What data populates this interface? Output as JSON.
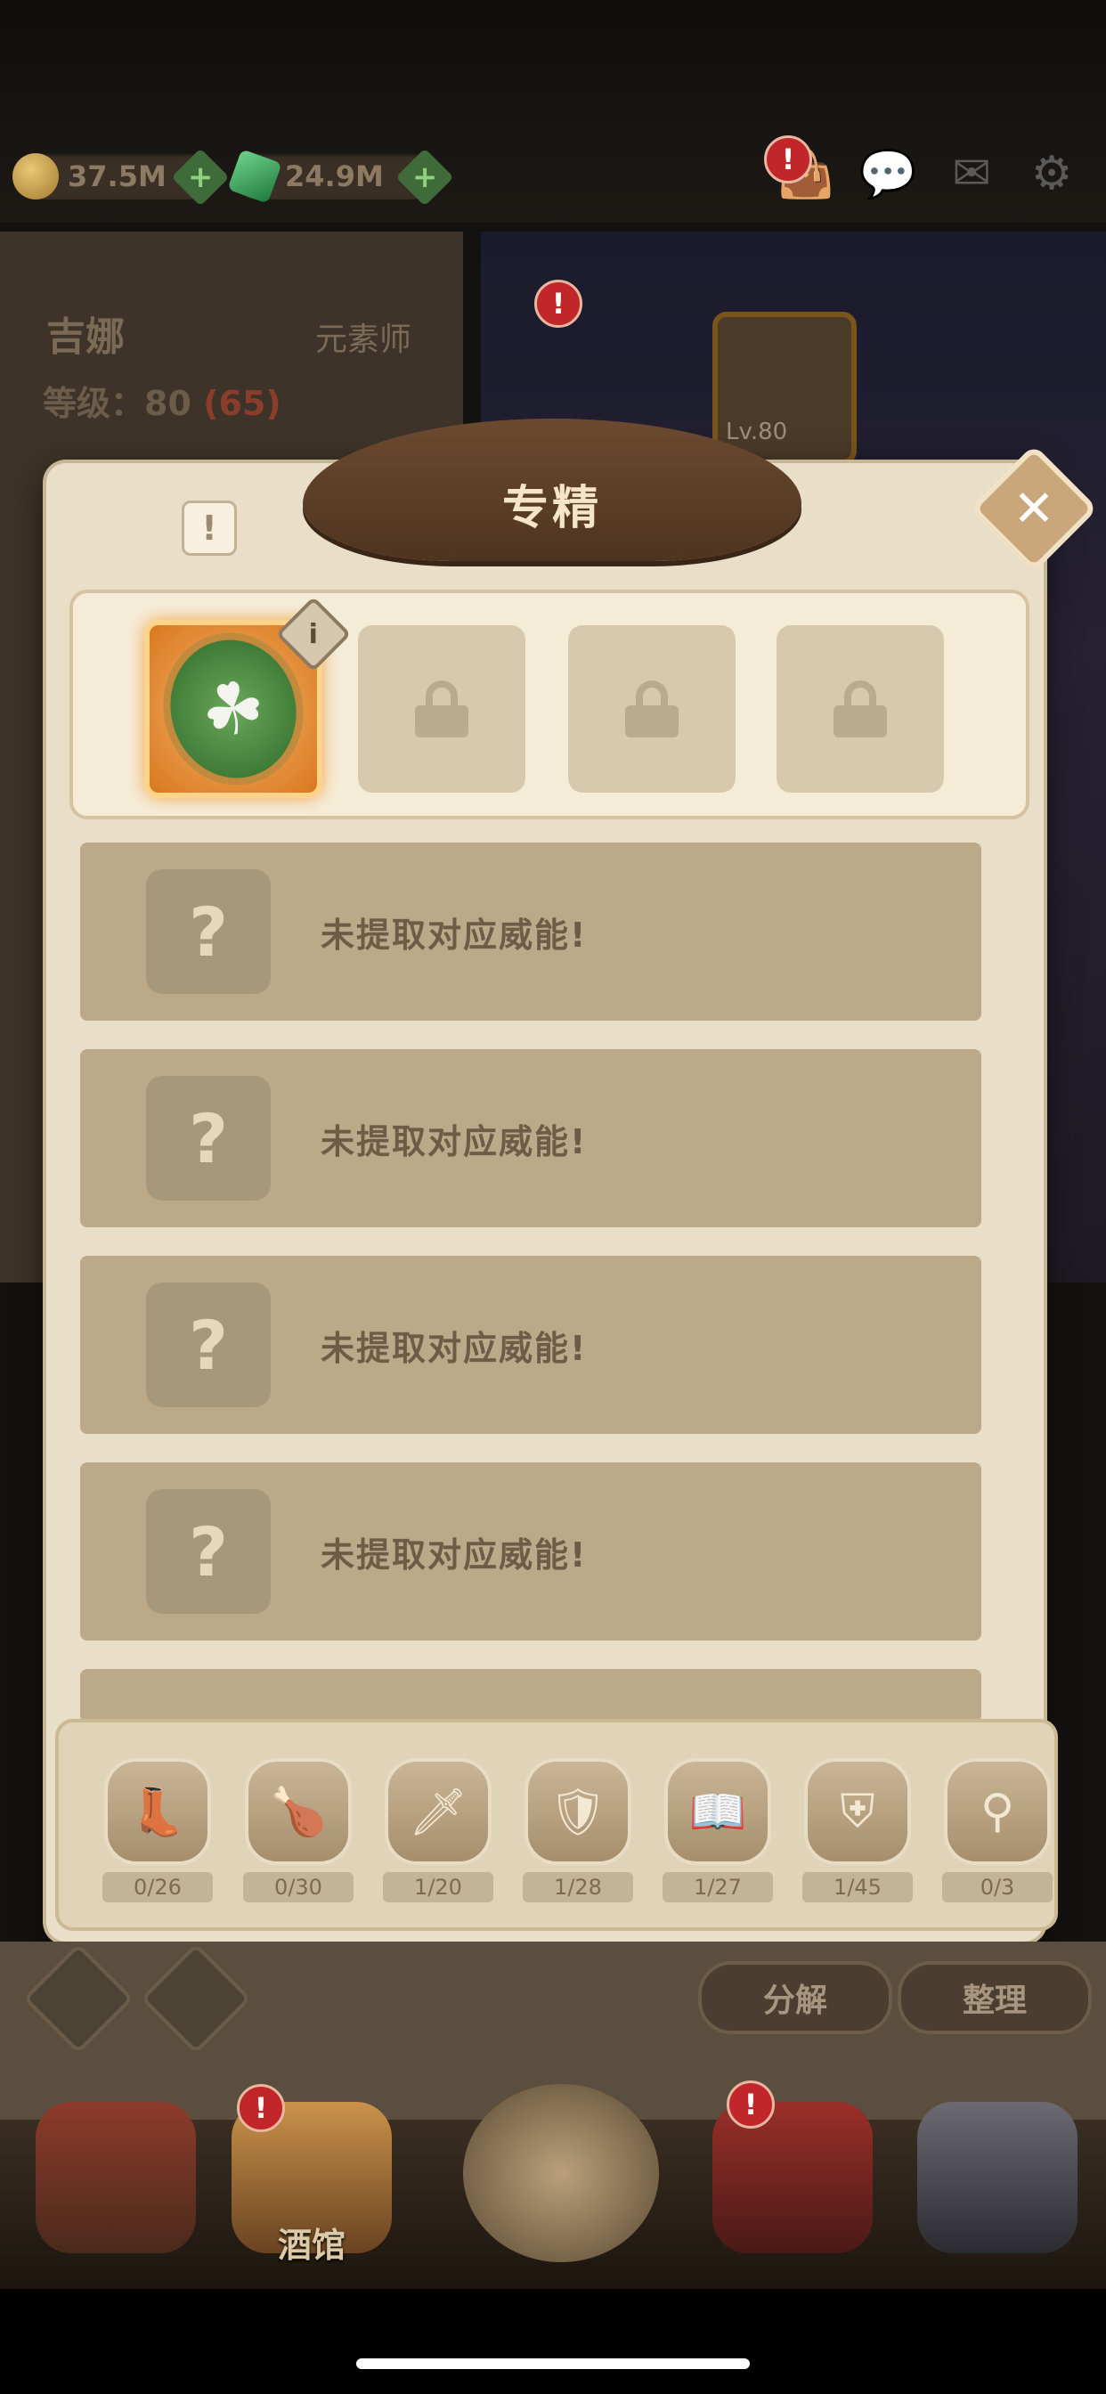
{
  "currency": {
    "gold": "37.5M",
    "gems": "24.9M"
  },
  "hero": {
    "name": "吉娜",
    "class": "元素师",
    "level_label": "等级：",
    "level": "80",
    "level_bonus": "(65)",
    "equip_level": "Lv.80"
  },
  "modal": {
    "title": "专精",
    "close_symbol": "✕",
    "info_symbol": "!",
    "slots": [
      {
        "state": "active",
        "icon": "clover-emblem"
      },
      {
        "state": "locked",
        "icon": "lock-icon"
      },
      {
        "state": "locked",
        "icon": "lock-icon"
      },
      {
        "state": "locked",
        "icon": "lock-icon"
      }
    ],
    "rows": [
      {
        "symbol": "?",
        "text": "未提取对应威能!"
      },
      {
        "symbol": "?",
        "text": "未提取对应威能!"
      },
      {
        "symbol": "?",
        "text": "未提取对应威能!"
      },
      {
        "symbol": "?",
        "text": "未提取对应威能!"
      }
    ]
  },
  "categories": [
    {
      "icon": "boot-icon",
      "glyph": "👢",
      "count": "0/26"
    },
    {
      "icon": "drumstick-icon",
      "glyph": "🍗",
      "count": "0/30"
    },
    {
      "icon": "sword-icon",
      "glyph": "🗡",
      "count": "1/20"
    },
    {
      "icon": "shield-icon",
      "glyph": "🛡",
      "count": "1/28"
    },
    {
      "icon": "book-icon",
      "glyph": "📖",
      "count": "1/27"
    },
    {
      "icon": "armor-icon",
      "glyph": "⛨",
      "count": "1/45"
    },
    {
      "icon": "staff-icon",
      "glyph": "⚲",
      "count": "0/3"
    }
  ],
  "actions": {
    "decompose": "分解",
    "organize": "整理"
  },
  "nav": {
    "tavern": "酒馆"
  },
  "colors": {
    "modal_bg": "#e9dfc8",
    "row_bg": "#bba98a",
    "active_slot": "#e8913a",
    "alert": "#c0262a"
  }
}
